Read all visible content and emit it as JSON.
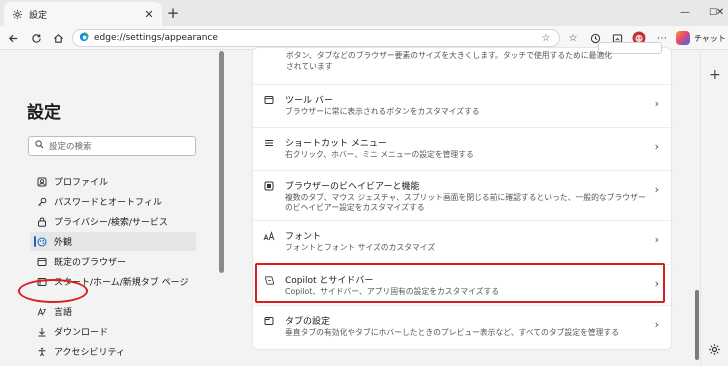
{
  "tab": {
    "title": "設定",
    "close": "✕",
    "new_tab": "+"
  },
  "window_controls": {
    "minimize": "—",
    "maximize": "☐",
    "close": "✕"
  },
  "address_bar": {
    "url": "edge://settings/appearance"
  },
  "chat_label": "チャット",
  "settings_nav": {
    "title": "設定",
    "search_placeholder": "設定の検索",
    "items": [
      {
        "label": "プロファイル",
        "icon": "profile-icon"
      },
      {
        "label": "パスワードとオートフィル",
        "icon": "key-icon"
      },
      {
        "label": "プライバシー/検索/サービス",
        "icon": "lock-icon"
      },
      {
        "label": "外観",
        "icon": "appearance-icon",
        "active": true
      },
      {
        "label": "既定のブラウザー",
        "icon": "browser-icon"
      },
      {
        "label": "スタート/ホーム/新規タブ ページ",
        "icon": "home-icon"
      },
      {
        "label": "言語",
        "icon": "language-icon"
      },
      {
        "label": "ダウンロード",
        "icon": "download-icon"
      },
      {
        "label": "アクセシビリティ",
        "icon": "accessibility-icon"
      }
    ]
  },
  "content": {
    "top_description": "ボタン、タブなどのブラウザー要素のサイズを大きくします。タッチで使用するために最適化されています",
    "rows": [
      {
        "title": "ツール バー",
        "desc": "ブラウザーに常に表示されるボタンをカスタマイズする",
        "icon": "toolbar-icon"
      },
      {
        "title": "ショートカット メニュー",
        "desc": "右クリック、ホバー、ミニ メニューの設定を管理する",
        "icon": "menu-icon"
      },
      {
        "title": "ブラウザーのビヘイビアーと機能",
        "desc": "複数のタブ、マウス ジェスチャ、スプリット画面を閉じる前に確認するといった、一般的なブラウザー",
        "desc2": "のビヘイビアー設定をカスタマイズする",
        "icon": "behavior-icon"
      },
      {
        "title": "フォント",
        "desc": "フォントとフォント サイズのカスタマイズ",
        "icon": "font-icon"
      },
      {
        "title": "Copilot とサイドバー",
        "desc": "Copilot、サイドバー、アプリ固有の設定をカスタマイズする",
        "icon": "copilot-icon",
        "highlighted": true
      },
      {
        "title": "タブの設定",
        "desc": "垂直タブの有効化やタブにホバーしたときのプレビュー表示など、すべてのタブ設定を管理する",
        "icon": "tab-icon"
      }
    ],
    "chevron": "›"
  },
  "colors": {
    "accent": "#0f6cbd",
    "highlight": "#d81e1e"
  }
}
